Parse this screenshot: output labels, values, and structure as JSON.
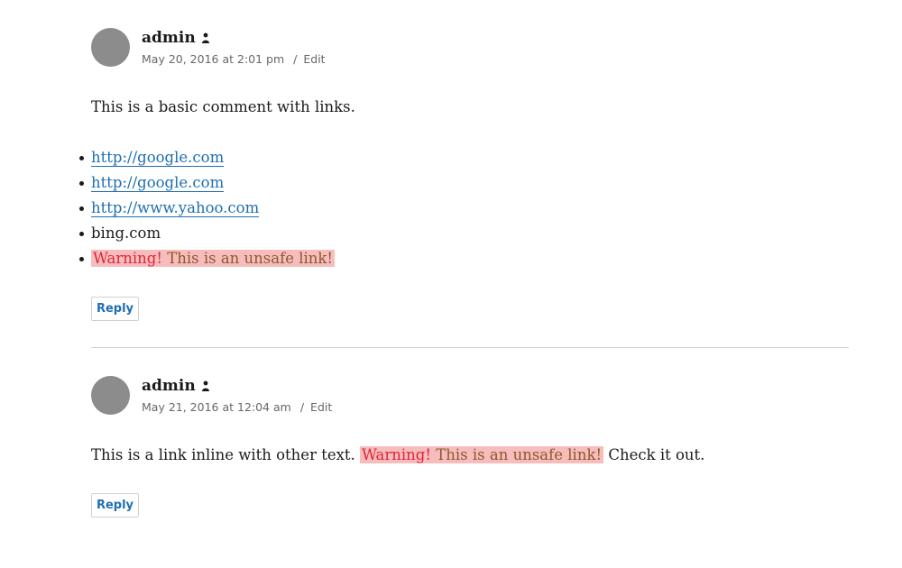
{
  "comments": [
    {
      "author": "admin",
      "date": "May 20, 2016 at 2:01 pm",
      "separator": "/",
      "edit_label": "Edit",
      "text": "This is a basic comment with links.",
      "links": [
        {
          "text": "http://google.com",
          "type": "link"
        },
        {
          "text": "http://google.com",
          "type": "link"
        },
        {
          "text": "http://www.yahoo.com",
          "type": "link"
        },
        {
          "text": "bing.com",
          "type": "plain"
        }
      ],
      "unsafe_warning": "Warning!",
      "unsafe_message": "This is an unsafe link!",
      "reply_label": "Reply"
    },
    {
      "author": "admin",
      "date": "May 21, 2016 at 12:04 am",
      "separator": "/",
      "edit_label": "Edit",
      "text_before": "This is a link inline with other text.",
      "unsafe_warning": "Warning!",
      "unsafe_message": "This is an unsafe link!",
      "text_after": "Check it out.",
      "reply_label": "Reply"
    }
  ],
  "icons": {
    "author_badge": "person-icon",
    "avatar": "avatar-placeholder"
  },
  "colors": {
    "link": "#1f6fb2",
    "unsafe_bg": "#f7bdbd",
    "warning_text": "#e0243a",
    "avatar": "#8c8c8c"
  }
}
